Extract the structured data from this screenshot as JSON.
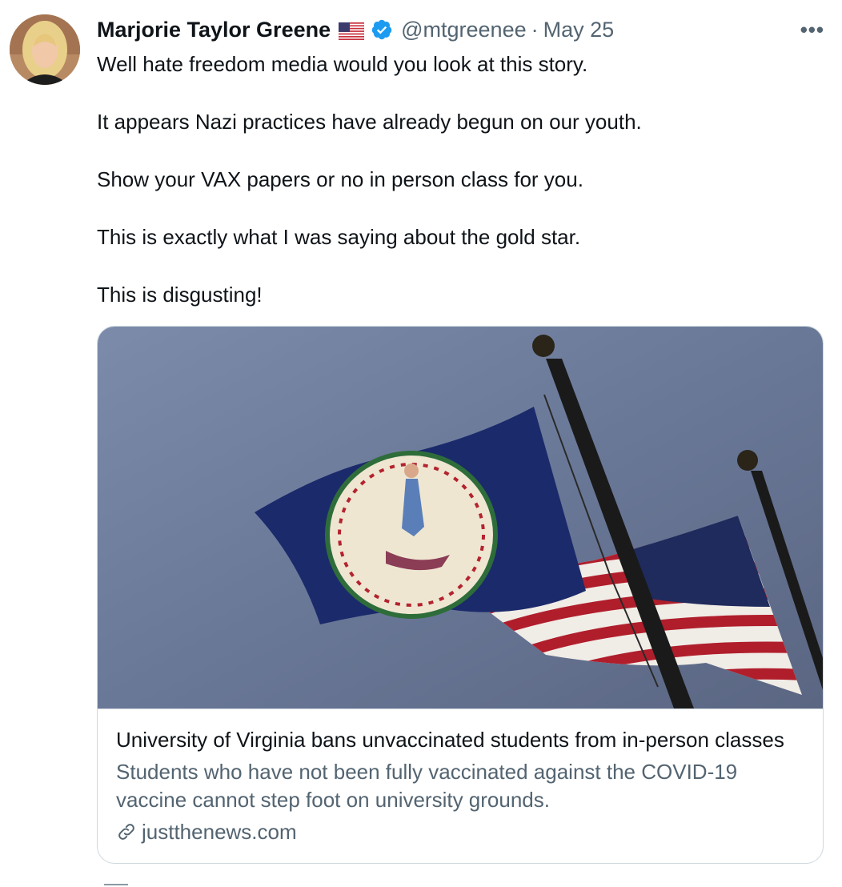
{
  "tweet": {
    "author_name": "Marjorie Taylor Greene",
    "author_flag": "us-flag-icon",
    "verified": "verified-badge-icon",
    "handle": "@mtgreenee",
    "separator": "·",
    "date": "May 25",
    "more": "•••",
    "paragraphs": [
      "Well hate freedom media would you look at this story.",
      "It appears Nazi practices have already begun on our youth.",
      "Show your VAX papers or no in person class for you.",
      "This is exactly what I was saying about the gold star.",
      "This is disgusting!"
    ]
  },
  "card": {
    "title": "University of Virginia bans unvaccinated students from in-person classes",
    "description": "Students who have not been fully vaccinated against the COVID-19 vaccine cannot step foot on university grounds.",
    "domain": "justthenews.com",
    "image": "flags-photo"
  },
  "colors": {
    "text": "#0f1419",
    "secondary": "#536471",
    "verified": "#1d9bf0",
    "border": "#cfd9de"
  }
}
